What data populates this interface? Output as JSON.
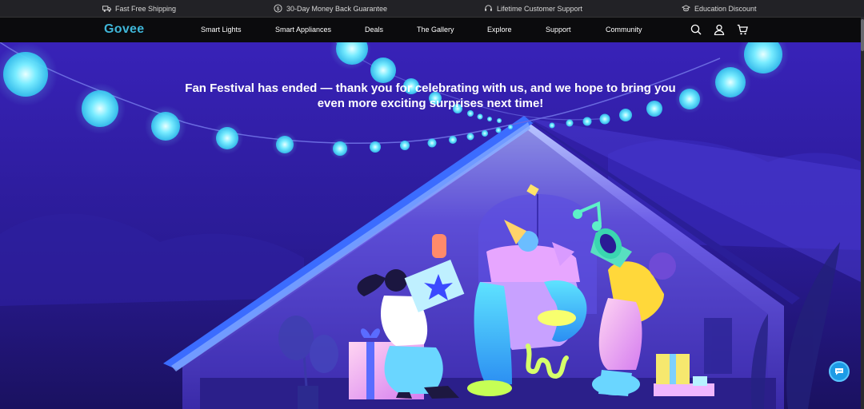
{
  "topbar": {
    "items": [
      {
        "label": "Fast Free Shipping",
        "icon": "truck-icon"
      },
      {
        "label": "30-Day Money Back Guarantee",
        "icon": "dollar-circle-icon"
      },
      {
        "label": "Lifetime Customer Support",
        "icon": "headset-icon"
      },
      {
        "label": "Education Discount",
        "icon": "graduation-cap-icon"
      }
    ]
  },
  "nav": {
    "logo": "Govee",
    "links": [
      "Smart Lights",
      "Smart Appliances",
      "Deals",
      "The Gallery",
      "Explore",
      "Support",
      "Community"
    ],
    "icons": [
      "search-icon",
      "user-icon",
      "cart-icon"
    ]
  },
  "hero": {
    "headline": "Fan Festival has ended — thank you for celebrating with us, and we hope to bring you even more exciting surprises next time!"
  },
  "chat": {
    "icon": "chat-bubble-icon"
  },
  "colors": {
    "accent": "#3fb6d8",
    "hero_bg": "#2a1a9c",
    "bulb": "#6fe9ff"
  }
}
